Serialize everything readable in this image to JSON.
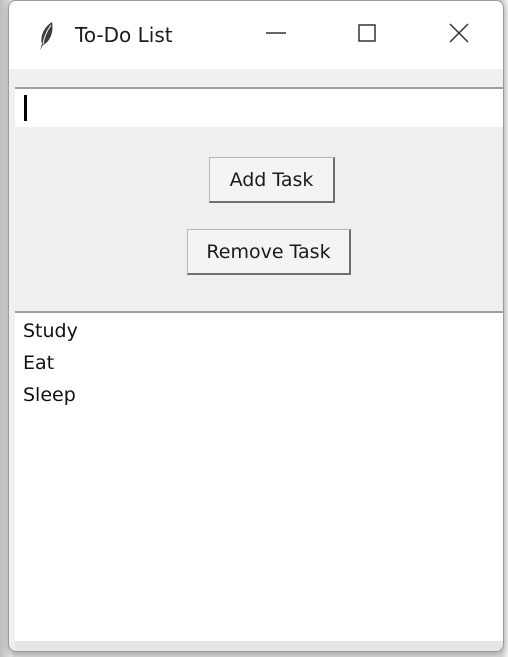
{
  "window": {
    "title": "To-Do List",
    "icon": "feather-icon",
    "controls": [
      "minimize-icon",
      "maximize-icon",
      "close-icon"
    ]
  },
  "entry": {
    "value": "",
    "placeholder": ""
  },
  "buttons": {
    "add_label": "Add Task",
    "remove_label": "Remove Task"
  },
  "tasks": {
    "items": [
      {
        "label": "Study"
      },
      {
        "label": "Eat"
      },
      {
        "label": "Sleep"
      }
    ]
  },
  "colors": {
    "window_bg": "#f0f0f0",
    "titlebar_bg": "#ffffff",
    "listbox_bg": "#ffffff"
  }
}
